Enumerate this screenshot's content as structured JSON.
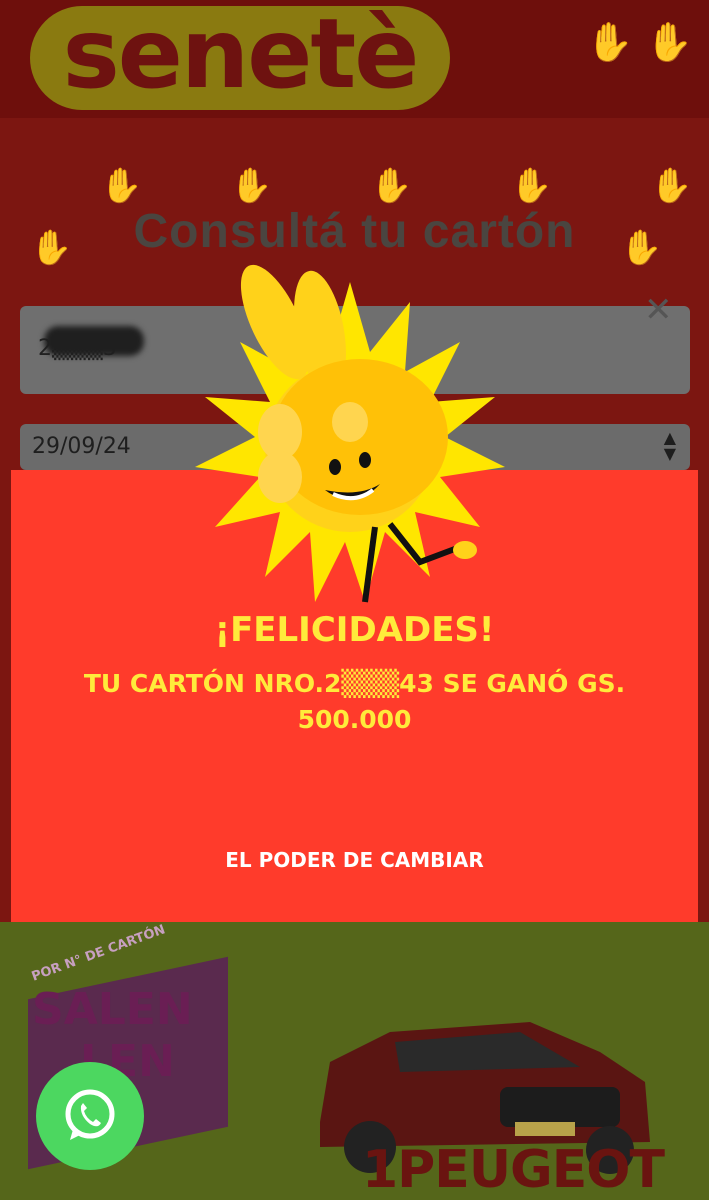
{
  "header": {
    "logo_text": "senetè"
  },
  "form": {
    "title": "Consultá tu cartón",
    "card_number_value": "2▒▒▒3",
    "date_value": "29/09/24"
  },
  "modal": {
    "headline": "¡FELICIDADES!",
    "prize_text": "TU CARTÓN NRO.2▒▒▒43 SE GANÓ GS. 500.000",
    "tagline": "EL PODER DE CAMBIAR"
  },
  "promo": {
    "small_text": "POR N° DE CARTÓN",
    "salen_line1": "SALEN",
    "salen_line2": "LEN",
    "car_text": "1PEUGEOT"
  },
  "colors": {
    "modal_bg": "#ff3b2b",
    "headline": "#ffeb3b",
    "whatsapp": "#4cd760"
  }
}
